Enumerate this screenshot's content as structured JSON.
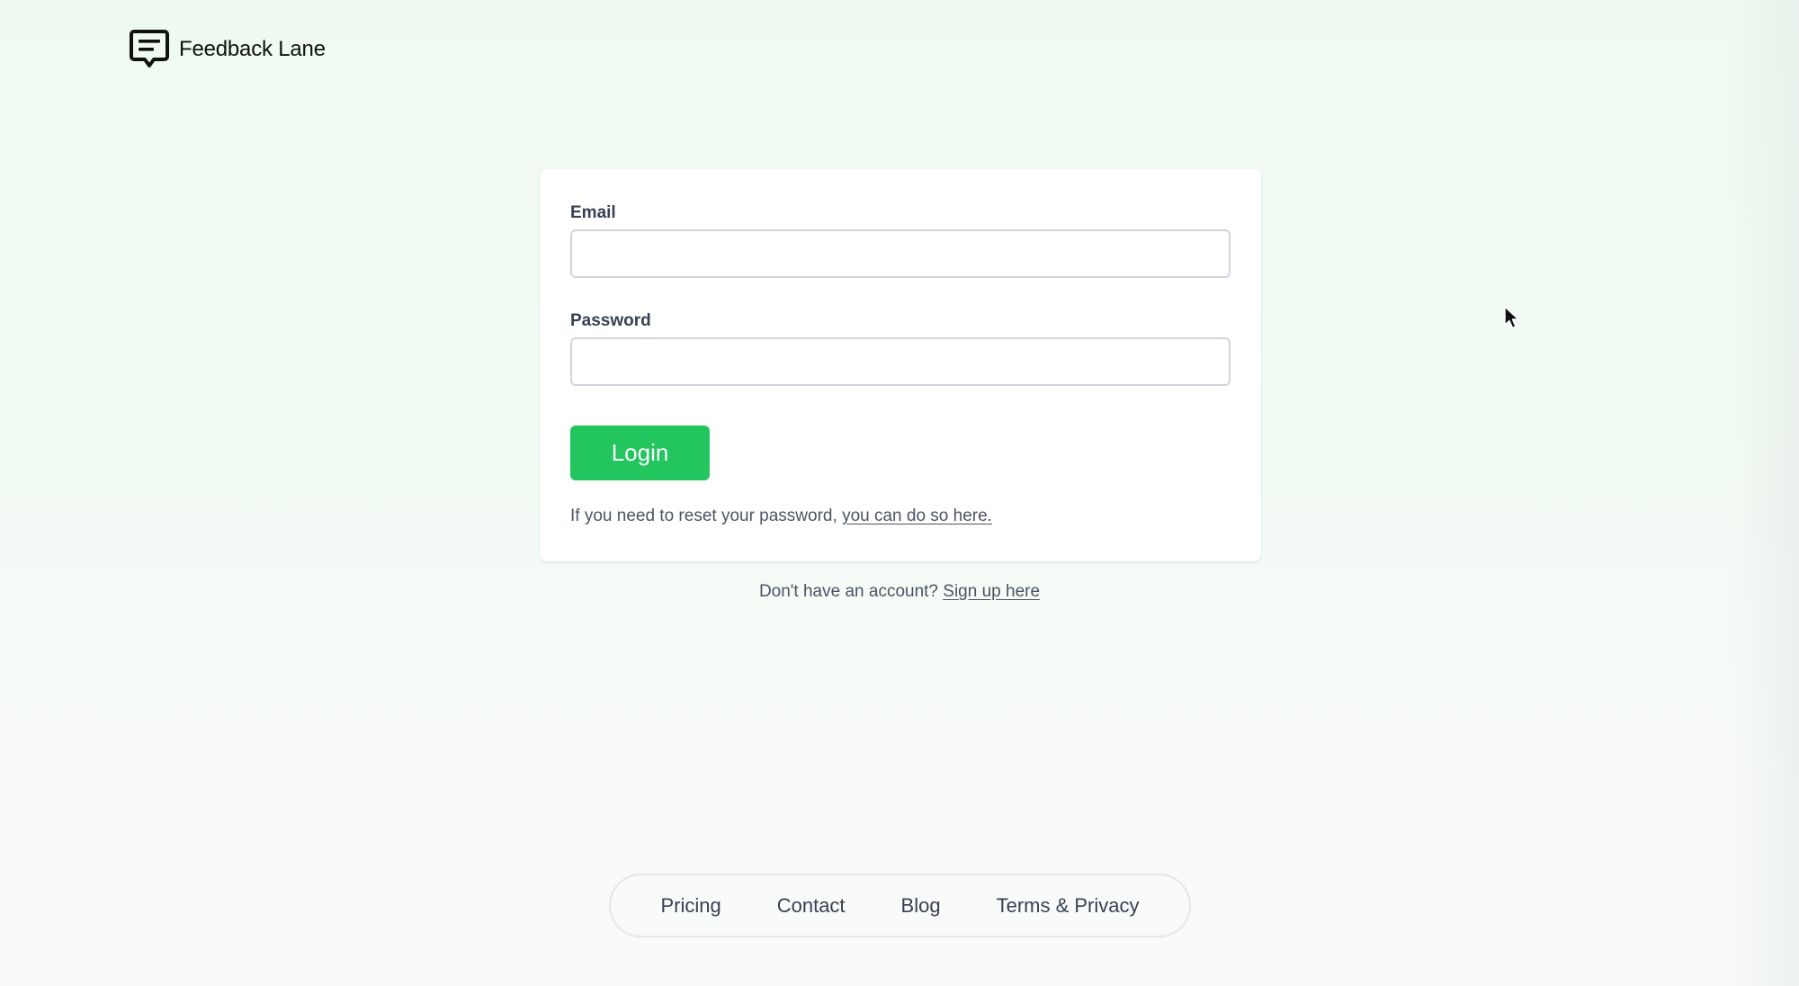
{
  "header": {
    "brand_name": "Feedback Lane",
    "logo_icon": "chat-bubble-logo-icon"
  },
  "login_form": {
    "email_label": "Email",
    "email_value": "",
    "password_label": "Password",
    "password_value": "",
    "login_button_label": "Login",
    "reset_prefix": "If you need to reset your password, ",
    "reset_link": "you can do so here."
  },
  "signup": {
    "prefix": "Don't have an account? ",
    "link": "Sign up here"
  },
  "footer": {
    "links": [
      "Pricing",
      "Contact",
      "Blog",
      "Terms & Privacy"
    ]
  },
  "colors": {
    "accent_green": "#22c55e",
    "background_tint": "#eefaf1",
    "text_muted": "#4b5563"
  }
}
